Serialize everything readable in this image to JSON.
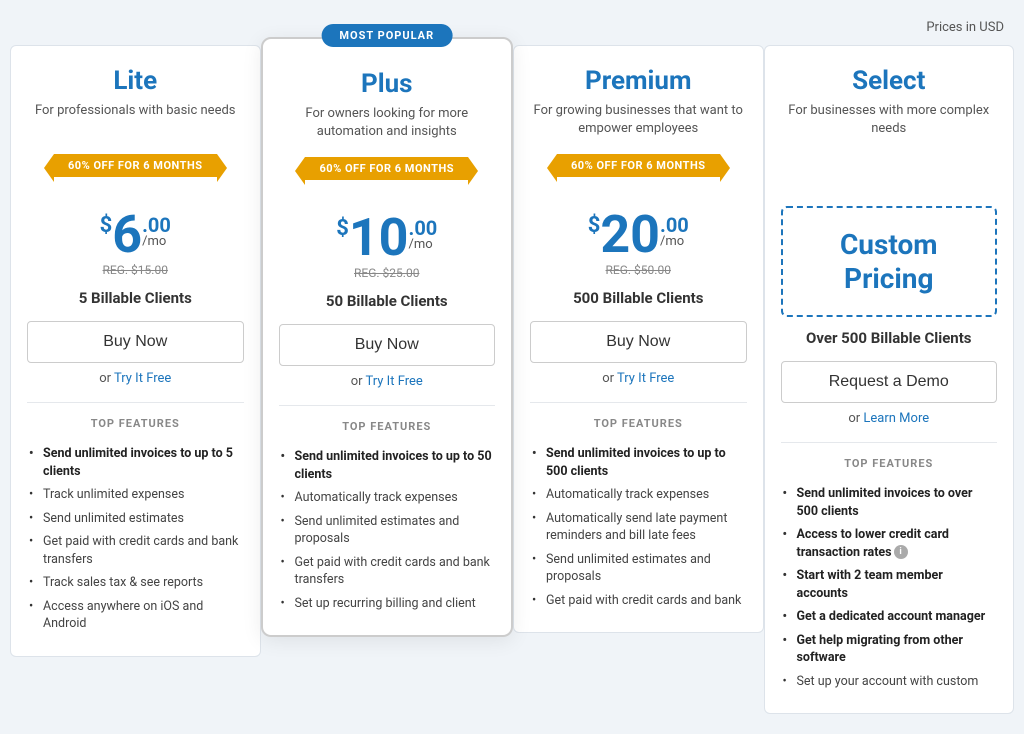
{
  "page": {
    "prices_label": "Prices in USD"
  },
  "plans": [
    {
      "id": "lite",
      "name": "Lite",
      "description": "For professionals with basic needs",
      "popular": false,
      "discount_banner": "60% OFF FOR 6 MONTHS",
      "price_dollar": "$",
      "price_amount": "6",
      "price_cents": ".00",
      "price_mo": "/mo",
      "price_reg": "REG. $15.00",
      "billable_clients": "5 Billable Clients",
      "btn_label": "Buy Now",
      "or_text": "or",
      "link_label": "Try It Free",
      "features_title": "TOP FEATURES",
      "features": [
        {
          "text": "Send unlimited invoices to up to 5 clients",
          "bold": true
        },
        {
          "text": "Track unlimited expenses",
          "bold": false
        },
        {
          "text": "Send unlimited estimates",
          "bold": false
        },
        {
          "text": "Get paid with credit cards and bank transfers",
          "bold": false
        },
        {
          "text": "Track sales tax & see reports",
          "bold": false
        },
        {
          "text": "Access anywhere on iOS and Android",
          "bold": false
        }
      ]
    },
    {
      "id": "plus",
      "name": "Plus",
      "description": "For owners looking for more automation and insights",
      "popular": true,
      "most_popular_label": "MOST POPULAR",
      "discount_banner": "60% OFF FOR 6 MONTHS",
      "price_dollar": "$",
      "price_amount": "10",
      "price_cents": ".00",
      "price_mo": "/mo",
      "price_reg": "REG. $25.00",
      "billable_clients": "50 Billable Clients",
      "btn_label": "Buy Now",
      "or_text": "or",
      "link_label": "Try It Free",
      "features_title": "TOP FEATURES",
      "features": [
        {
          "text": "Send unlimited invoices to up to 50 clients",
          "bold": true
        },
        {
          "text": "Automatically track expenses",
          "bold": false
        },
        {
          "text": "Send unlimited estimates and proposals",
          "bold": false
        },
        {
          "text": "Get paid with credit cards and bank transfers",
          "bold": false
        },
        {
          "text": "Set up recurring billing and client",
          "bold": false
        }
      ]
    },
    {
      "id": "premium",
      "name": "Premium",
      "description": "For growing businesses that want to empower employees",
      "popular": false,
      "discount_banner": "60% OFF FOR 6 MONTHS",
      "price_dollar": "$",
      "price_amount": "20",
      "price_cents": ".00",
      "price_mo": "/mo",
      "price_reg": "REG. $50.00",
      "billable_clients": "500 Billable Clients",
      "btn_label": "Buy Now",
      "or_text": "or",
      "link_label": "Try It Free",
      "features_title": "TOP FEATURES",
      "features": [
        {
          "text": "Send unlimited invoices to up to 500 clients",
          "bold": true
        },
        {
          "text": "Automatically track expenses",
          "bold": false
        },
        {
          "text": "Automatically send late payment reminders and bill late fees",
          "bold": false
        },
        {
          "text": "Send unlimited estimates and proposals",
          "bold": false
        },
        {
          "text": "Get paid with credit cards and bank",
          "bold": false
        }
      ]
    },
    {
      "id": "select",
      "name": "Select",
      "description": "For businesses with more complex needs",
      "popular": false,
      "custom_pricing_text": "Custom Pricing",
      "billable_clients": "Over 500 Billable Clients",
      "btn_label": "Request a Demo",
      "or_text": "or",
      "link_label": "Learn More",
      "features_title": "TOP FEATURES",
      "features": [
        {
          "text": "Send unlimited invoices to over 500 clients",
          "bold": true
        },
        {
          "text": "Access to lower credit card transaction rates",
          "bold": true,
          "info": true
        },
        {
          "text": "Start with 2 team member accounts",
          "bold": true
        },
        {
          "text": "Get a dedicated account manager",
          "bold": true
        },
        {
          "text": "Get help migrating from other software",
          "bold": true
        },
        {
          "text": "Set up your account with custom",
          "bold": false
        }
      ]
    }
  ]
}
